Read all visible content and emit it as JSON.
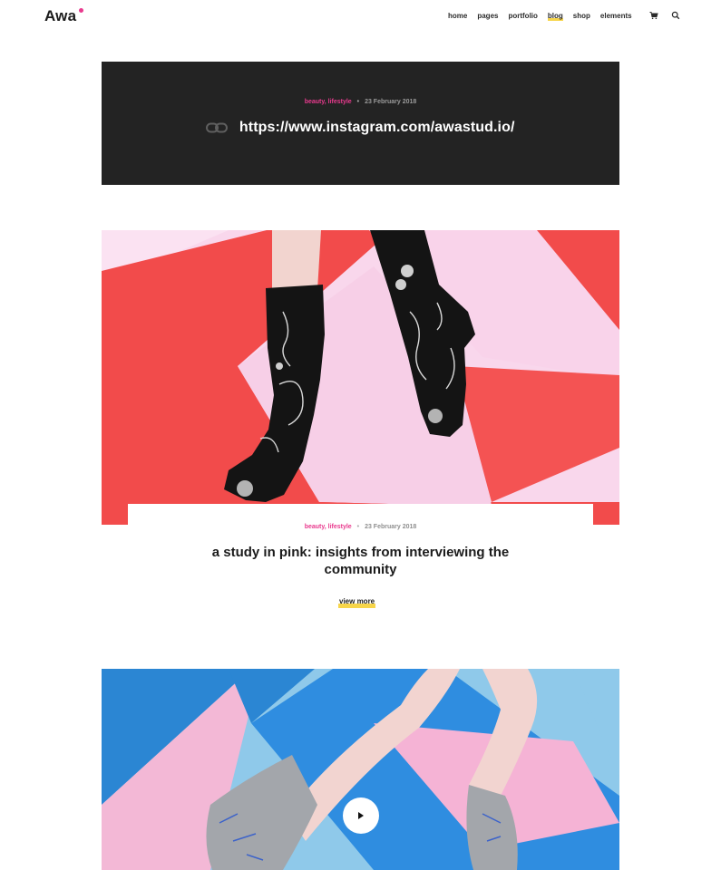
{
  "header": {
    "logo": "Awa",
    "nav": [
      "home",
      "pages",
      "portfolio",
      "blog",
      "shop",
      "elements"
    ],
    "active_nav": "blog",
    "icons": [
      "cart-icon",
      "search-icon"
    ]
  },
  "link_post": {
    "categories": "beauty, lifestyle",
    "separator": "•",
    "date": "23 February 2018",
    "url": "https://www.instagram.com/awastud.io/"
  },
  "image_post": {
    "categories": "beauty, lifestyle",
    "separator": "•",
    "date": "23 February 2018",
    "title": "a study in pink: insights from interviewing the community",
    "button": "view more"
  },
  "video_post": {
    "icon": "play-icon"
  },
  "colors": {
    "accent_pink": "#e93a8e",
    "accent_yellow": "#f7d54a",
    "dark_panel": "#232323"
  }
}
